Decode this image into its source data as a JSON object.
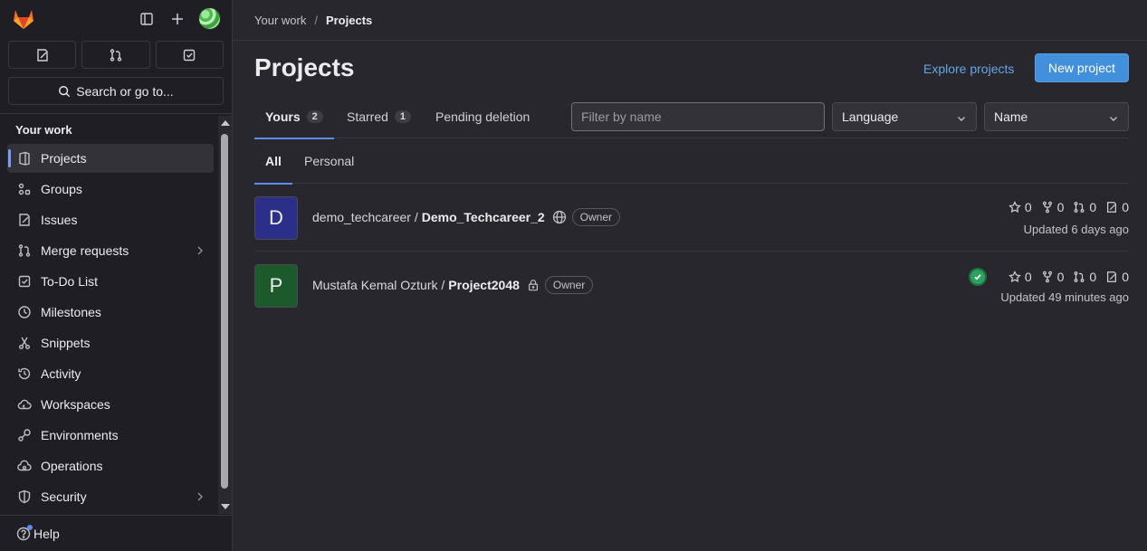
{
  "sidebar": {
    "search_label": "Search or go to...",
    "section_title": "Your work",
    "items": [
      {
        "label": "Projects",
        "icon": "project-icon",
        "active": true
      },
      {
        "label": "Groups",
        "icon": "group-icon"
      },
      {
        "label": "Issues",
        "icon": "issues-icon"
      },
      {
        "label": "Merge requests",
        "icon": "merge-request-icon",
        "has_chevron": true
      },
      {
        "label": "To-Do List",
        "icon": "todo-icon"
      },
      {
        "label": "Milestones",
        "icon": "clock-icon"
      },
      {
        "label": "Snippets",
        "icon": "snippet-icon"
      },
      {
        "label": "Activity",
        "icon": "history-icon"
      },
      {
        "label": "Workspaces",
        "icon": "cloud-icon"
      },
      {
        "label": "Environments",
        "icon": "environment-icon"
      },
      {
        "label": "Operations",
        "icon": "operations-icon"
      },
      {
        "label": "Security",
        "icon": "shield-icon",
        "has_chevron": true
      }
    ],
    "help_label": "Help"
  },
  "breadcrumb": {
    "parent": "Your work",
    "current": "Projects"
  },
  "page": {
    "title": "Projects",
    "explore_label": "Explore projects",
    "new_project_label": "New project"
  },
  "tabs": [
    {
      "label": "Yours",
      "count": "2",
      "active": true
    },
    {
      "label": "Starred",
      "count": "1"
    },
    {
      "label": "Pending deletion"
    }
  ],
  "filter": {
    "placeholder": "Filter by name",
    "language_label": "Language",
    "sort_label": "Name"
  },
  "subtabs": [
    {
      "label": "All",
      "active": true
    },
    {
      "label": "Personal"
    }
  ],
  "projects": [
    {
      "initial": "D",
      "namespace": "demo_techcareer /",
      "name": "Demo_Techcareer_2",
      "visibility": "globe-icon",
      "role": "Owner",
      "stars": "0",
      "forks": "0",
      "merge_requests": "0",
      "issues": "0",
      "updated": "Updated 6 days ago",
      "avatar_color": "#2c2f8a",
      "pipeline": false
    },
    {
      "initial": "P",
      "namespace": "Mustafa Kemal Ozturk /",
      "name": "Project2048",
      "visibility": "lock-icon",
      "role": "Owner",
      "stars": "0",
      "forks": "0",
      "merge_requests": "0",
      "issues": "0",
      "updated": "Updated 49 minutes ago",
      "avatar_color": "#1c5a2c",
      "pipeline": true
    }
  ],
  "colors": {
    "accent": "#428fdc",
    "link": "#63a6e9",
    "pipeline_success": "#2da160"
  }
}
